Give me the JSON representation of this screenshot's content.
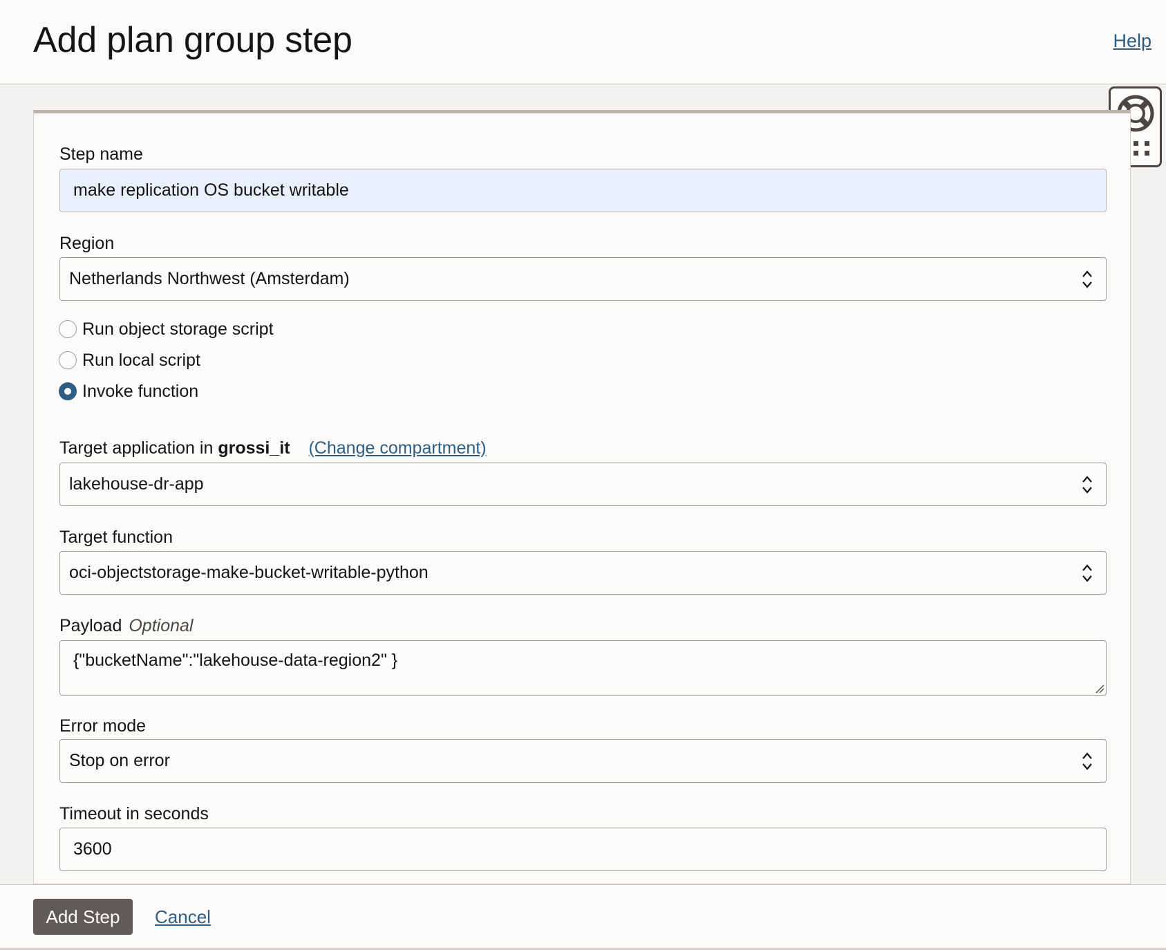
{
  "header": {
    "title": "Add plan group step",
    "help_label": "Help"
  },
  "form": {
    "step_name": {
      "label": "Step name",
      "value": "make replication OS bucket writable"
    },
    "region": {
      "label": "Region",
      "value": "Netherlands Northwest (Amsterdam)"
    },
    "script_options": [
      {
        "label": "Run object storage script",
        "checked": false
      },
      {
        "label": "Run local script",
        "checked": false
      },
      {
        "label": "Invoke function",
        "checked": true
      }
    ],
    "target_application": {
      "label_prefix": "Target application in",
      "compartment": "grossi_it",
      "change_link": "(Change compartment)",
      "value": "lakehouse-dr-app"
    },
    "target_function": {
      "label": "Target function",
      "value": "oci-objectstorage-make-bucket-writable-python"
    },
    "payload": {
      "label": "Payload",
      "optional_label": "Optional",
      "value": "{\"bucketName\":\"lakehouse-data-region2\" }"
    },
    "error_mode": {
      "label": "Error mode",
      "value": "Stop on error"
    },
    "timeout": {
      "label": "Timeout in seconds",
      "value": "3600"
    }
  },
  "footer": {
    "add_label": "Add Step",
    "cancel_label": "Cancel"
  },
  "side_widget": {
    "icons": [
      "lifebuoy-icon",
      "apps-grid-icon"
    ]
  },
  "colors": {
    "accent": "#2c5e86",
    "button": "#5f5b57",
    "autofill": "#e8effd",
    "background": "#f3f2f1",
    "surface": "#fcfbfa"
  }
}
